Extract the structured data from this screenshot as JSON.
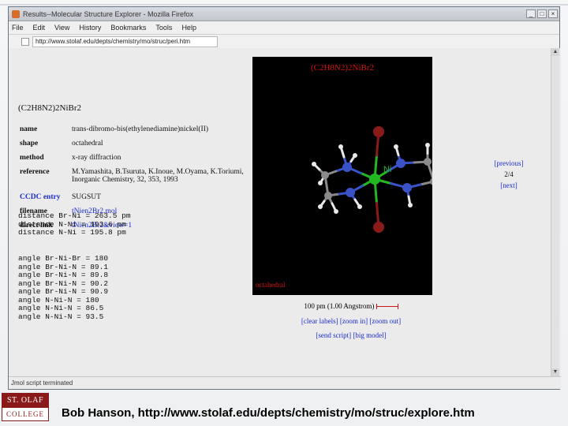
{
  "window": {
    "title": "Results--Molecular Structure Explorer - Mozilla Firefox",
    "btn_min": "_",
    "btn_max": "□",
    "btn_close": "×"
  },
  "menu": {
    "items": [
      "File",
      "Edit",
      "View",
      "History",
      "Bookmarks",
      "Tools",
      "Help"
    ]
  },
  "address": {
    "url": "http://www.stolaf.edu/depts/chemistry/mo/struc/peri.htm"
  },
  "page": {
    "formula": "(C2H8N2)2NiBr2",
    "properties": [
      {
        "key": "name",
        "value": "trans-dibromo-bis(ethylenediamine)nickel(II)"
      },
      {
        "key": "shape",
        "value": "octahedral"
      },
      {
        "key": "method",
        "value": "x-ray diffraction"
      },
      {
        "key": "reference",
        "value": "M.Yamashita, B.Tsuruta, K.Inoue, M.Oyama, K.Toriumi, Inorganic Chemistry, 32, 353, 1993"
      },
      {
        "key": "CCDC entry",
        "value": "SUGSUT"
      },
      {
        "key": "filename",
        "value": "tNien2Br2.mol"
      },
      {
        "key": "direct link",
        "value": "tNien2Br2&view=1"
      }
    ],
    "distances": [
      "distance Br-Ni = 263.5 pm",
      "distance N-Ni = 193.6 pm",
      "distance N-Ni = 195.8 pm"
    ],
    "angles": [
      "angle Br-Ni-Br = 180",
      "angle Br-Ni-N = 89.1",
      "angle Br-Ni-N = 89.8",
      "angle Br-Ni-N = 90.2",
      "angle Br-Ni-N = 90.9",
      "angle N-Ni-N = 180",
      "angle N-Ni-N = 86.5",
      "angle N-Ni-N = 93.5"
    ]
  },
  "viewer": {
    "title": "(C2H8N2)2NiBr2",
    "atom_label": "Ni",
    "shape_label": "octahedral",
    "scale_text": "100 pm (1.00 Angstrom)",
    "colors": {
      "ni": "#22b822",
      "br": "#8b1a1a",
      "n": "#3a52c8",
      "c": "#8a8a8a",
      "h": "#e8e8e8"
    }
  },
  "nav": {
    "previous": "[previous]",
    "counter": "2/4",
    "next": "[next]"
  },
  "links": {
    "clear_labels": "[clear labels]",
    "zoom_in": "[zoom in]",
    "zoom_out": "[zoom out]",
    "send_script": "[send script]",
    "big_model": "[big model]"
  },
  "status": "Jmol script terminated",
  "slide": {
    "logo_top": "ST. OLAF",
    "logo_bottom": "COLLEGE",
    "caption": "Bob Hanson, http://www.stolaf.edu/depts/chemistry/mo/struc/explore.htm"
  }
}
